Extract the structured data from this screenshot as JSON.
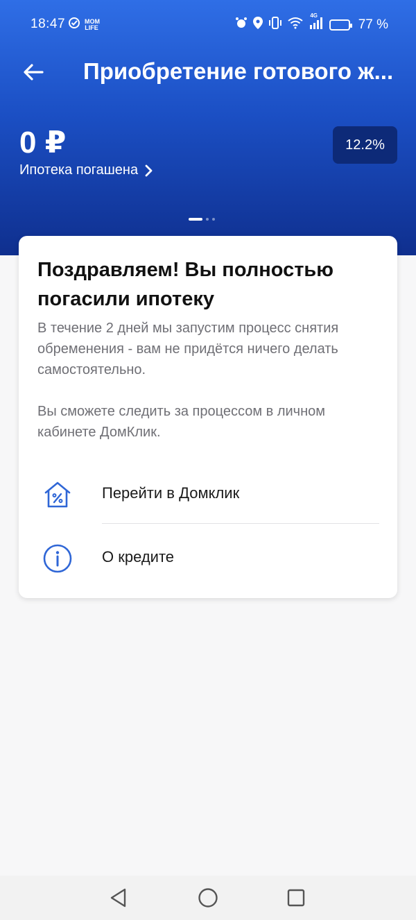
{
  "status_bar": {
    "time": "18:47",
    "badge_text": "MOM\nLIFE",
    "network": "4G",
    "battery_percent": "77 %",
    "battery_level": 0.77
  },
  "app_bar": {
    "title": "Приобретение готового ж..."
  },
  "summary": {
    "amount": "0 ₽",
    "status_link": "Ипотека погашена",
    "rate": "12.2%",
    "pager_total": 3,
    "pager_active": 1
  },
  "card": {
    "title": "Поздравляем! Вы полностью погасили ипотеку",
    "text_1": "В течение 2 дней мы запустим процесс снятия обременения - вам не придётся ничего делать самостоятельно.",
    "text_2": "Вы сможете следить за процессом в личном кабинете ДомКлик.",
    "actions": [
      {
        "label": "Перейти в Домклик",
        "icon": "house-percent-icon"
      },
      {
        "label": "О кредите",
        "icon": "info-icon"
      }
    ]
  },
  "colors": {
    "accent": "#2f6ee6",
    "badge_bg": "#0d2a78",
    "icon_blue": "#2f66d6"
  }
}
